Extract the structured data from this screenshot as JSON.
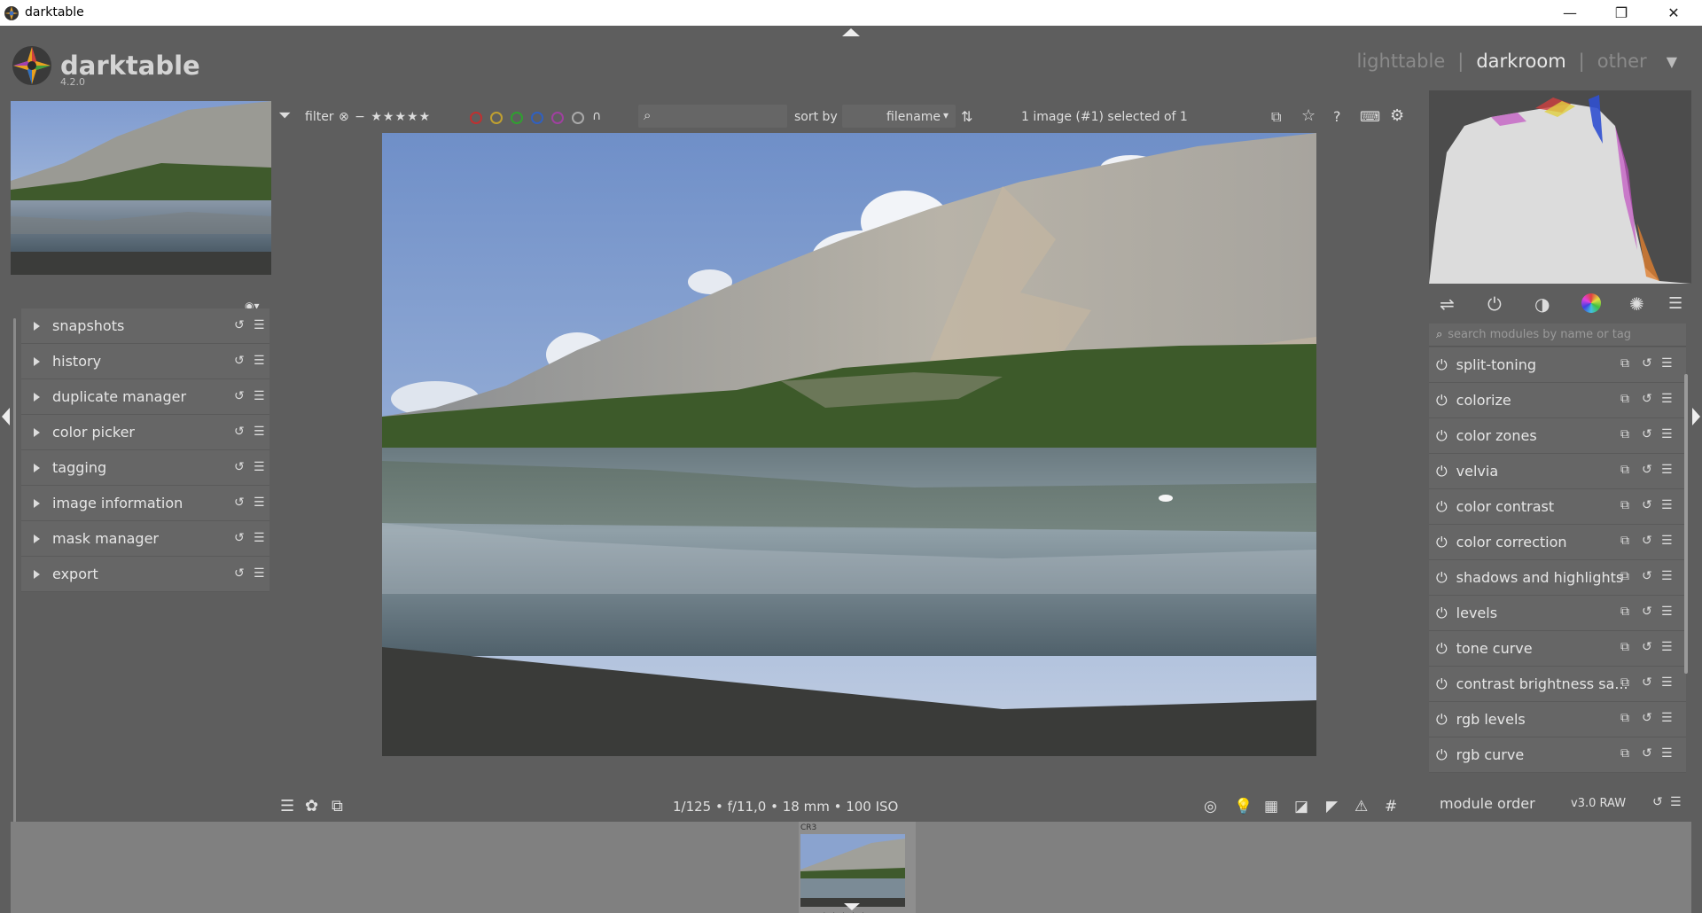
{
  "window": {
    "title": "darktable",
    "minimize_glyph": "—",
    "maximize_glyph": "❐",
    "close_glyph": "✕"
  },
  "header": {
    "brand": "darktable",
    "version": "4.2.0",
    "views": [
      "lighttable",
      "darkroom",
      "other"
    ],
    "active_view": "darkroom"
  },
  "filterbar": {
    "filter_label": "filter",
    "sort_label": "sort by",
    "sort_value": "filename",
    "selection_info": "1 image (#1) selected of 1",
    "color_labels": [
      "#c03030",
      "#c0a030",
      "#30a030",
      "#3060c0",
      "#a040a0"
    ]
  },
  "left_modules": [
    {
      "label": "snapshots"
    },
    {
      "label": "history"
    },
    {
      "label": "duplicate manager"
    },
    {
      "label": "color picker"
    },
    {
      "label": "tagging"
    },
    {
      "label": "image information"
    },
    {
      "label": "mask manager"
    },
    {
      "label": "export"
    }
  ],
  "right_panel": {
    "search_placeholder": "search modules by name or tag",
    "modules": [
      {
        "label": "split-toning"
      },
      {
        "label": "colorize"
      },
      {
        "label": "color zones"
      },
      {
        "label": "velvia"
      },
      {
        "label": "color contrast"
      },
      {
        "label": "color correction"
      },
      {
        "label": "shadows and highlights"
      },
      {
        "label": "levels"
      },
      {
        "label": "tone curve"
      },
      {
        "label": "contrast brightness sa..."
      },
      {
        "label": "rgb levels"
      },
      {
        "label": "rgb curve"
      }
    ],
    "footer_label": "module order",
    "footer_value": "v3.0 RAW"
  },
  "center": {
    "exif_info": "1/125 • f/11,0 • 18 mm • 100 ISO"
  },
  "filmstrip": {
    "format_label": "CR3",
    "stars": "☆☆☆☆☆",
    "reject_glyph": "⊗"
  }
}
